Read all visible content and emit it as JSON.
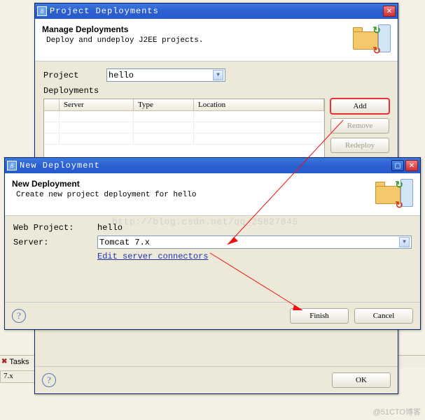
{
  "watermark": "http://blog.csdn.net/qq_25827845",
  "brand": "@51CTO博客",
  "dialog1": {
    "title": "Project Deployments",
    "heading": "Manage Deployments",
    "subheading": "Deploy and undeploy J2EE projects.",
    "project_label": "Project",
    "project_value": "hello",
    "deployments_label": "Deployments",
    "columns": {
      "server": "Server",
      "type": "Type",
      "location": "Location"
    },
    "buttons": {
      "add": "Add",
      "remove": "Remove",
      "redeploy": "Redeploy"
    },
    "footer": {
      "ok": "OK"
    }
  },
  "dialog2": {
    "title": "New Deployment",
    "heading": "New Deployment",
    "subheading": "Create new project deployment for hello",
    "web_project_label": "Web Project:",
    "web_project_value": "hello",
    "server_label": "Server:",
    "server_value": "Tomcat  7.x",
    "edit_link": "Edit server connectors",
    "footer": {
      "finish": "Finish",
      "cancel": "Cancel"
    }
  },
  "background": {
    "tasks": "Tasks",
    "server_row": "7.x"
  }
}
